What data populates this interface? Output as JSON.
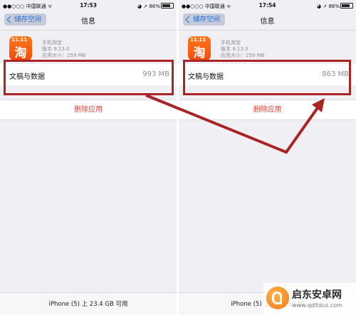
{
  "screens": [
    {
      "status": {
        "carrier": "●●○○○ 中国联通 ᯤ",
        "time": "17:53",
        "right": "◕ ➚ 86%"
      },
      "nav": {
        "back_label": "储存空间",
        "title": "信息"
      },
      "app": {
        "name": "手机淘宝",
        "version": "版本 9.13.0",
        "size": "应用大小：259 MB"
      },
      "data_row": {
        "label": "文稿与数据",
        "value": "993 MB"
      },
      "delete_label": "删除应用",
      "footer": "iPhone (5) 上 23.4 GB 可用"
    },
    {
      "status": {
        "carrier": "●●○○○ 中国联通 ᯤ",
        "time": "17:54",
        "right": "◕ ➚ 86%"
      },
      "nav": {
        "back_label": "储存空间",
        "title": "信息"
      },
      "app": {
        "name": "手机淘宝",
        "version": "版本 9.13.0",
        "size": "应用大小：259 MB"
      },
      "data_row": {
        "label": "文稿与数据",
        "value": "863 MB"
      },
      "delete_label": "删除应用",
      "footer": "iPhone (5) 上 23.4 GB 可"
    }
  ],
  "app_icon": {
    "badge": "11.11",
    "glyph": "淘"
  },
  "annotation": {
    "color": "#a92525"
  },
  "watermark": {
    "title": "启东安卓网",
    "url": "www.qdltdus.com"
  }
}
